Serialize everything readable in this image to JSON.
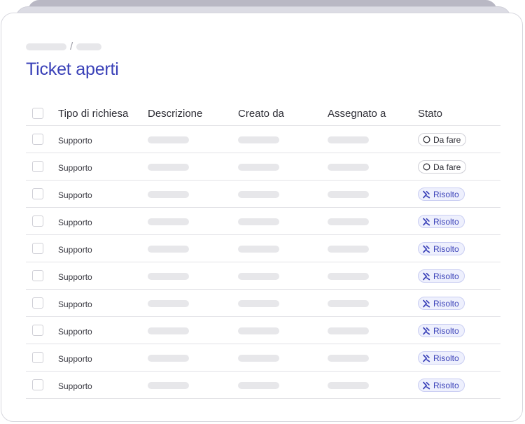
{
  "page_title": "Ticket aperti",
  "table": {
    "columns": [
      "Tipo di richiesa",
      "Descrizione",
      "Creato da",
      "Assegnato a",
      "Stato"
    ],
    "rows": [
      {
        "tipo": "Supporto",
        "stato": "Da fare",
        "stato_kind": "todo"
      },
      {
        "tipo": "Supporto",
        "stato": "Da fare",
        "stato_kind": "todo"
      },
      {
        "tipo": "Supporto",
        "stato": "Risolto",
        "stato_kind": "done"
      },
      {
        "tipo": "Supporto",
        "stato": "Risolto",
        "stato_kind": "done"
      },
      {
        "tipo": "Supporto",
        "stato": "Risolto",
        "stato_kind": "done"
      },
      {
        "tipo": "Supporto",
        "stato": "Risolto",
        "stato_kind": "done"
      },
      {
        "tipo": "Supporto",
        "stato": "Risolto",
        "stato_kind": "done"
      },
      {
        "tipo": "Supporto",
        "stato": "Risolto",
        "stato_kind": "done"
      },
      {
        "tipo": "Supporto",
        "stato": "Risolto",
        "stato_kind": "done"
      },
      {
        "tipo": "Supporto",
        "stato": "Risolto",
        "stato_kind": "done"
      }
    ]
  },
  "icons": {
    "todo": "circle-outline-icon",
    "done": "resolved-icon"
  },
  "colors": {
    "accent": "#3a41b8",
    "badge_done_bg": "#eef0fd",
    "skeleton": "#e7e7ea"
  }
}
